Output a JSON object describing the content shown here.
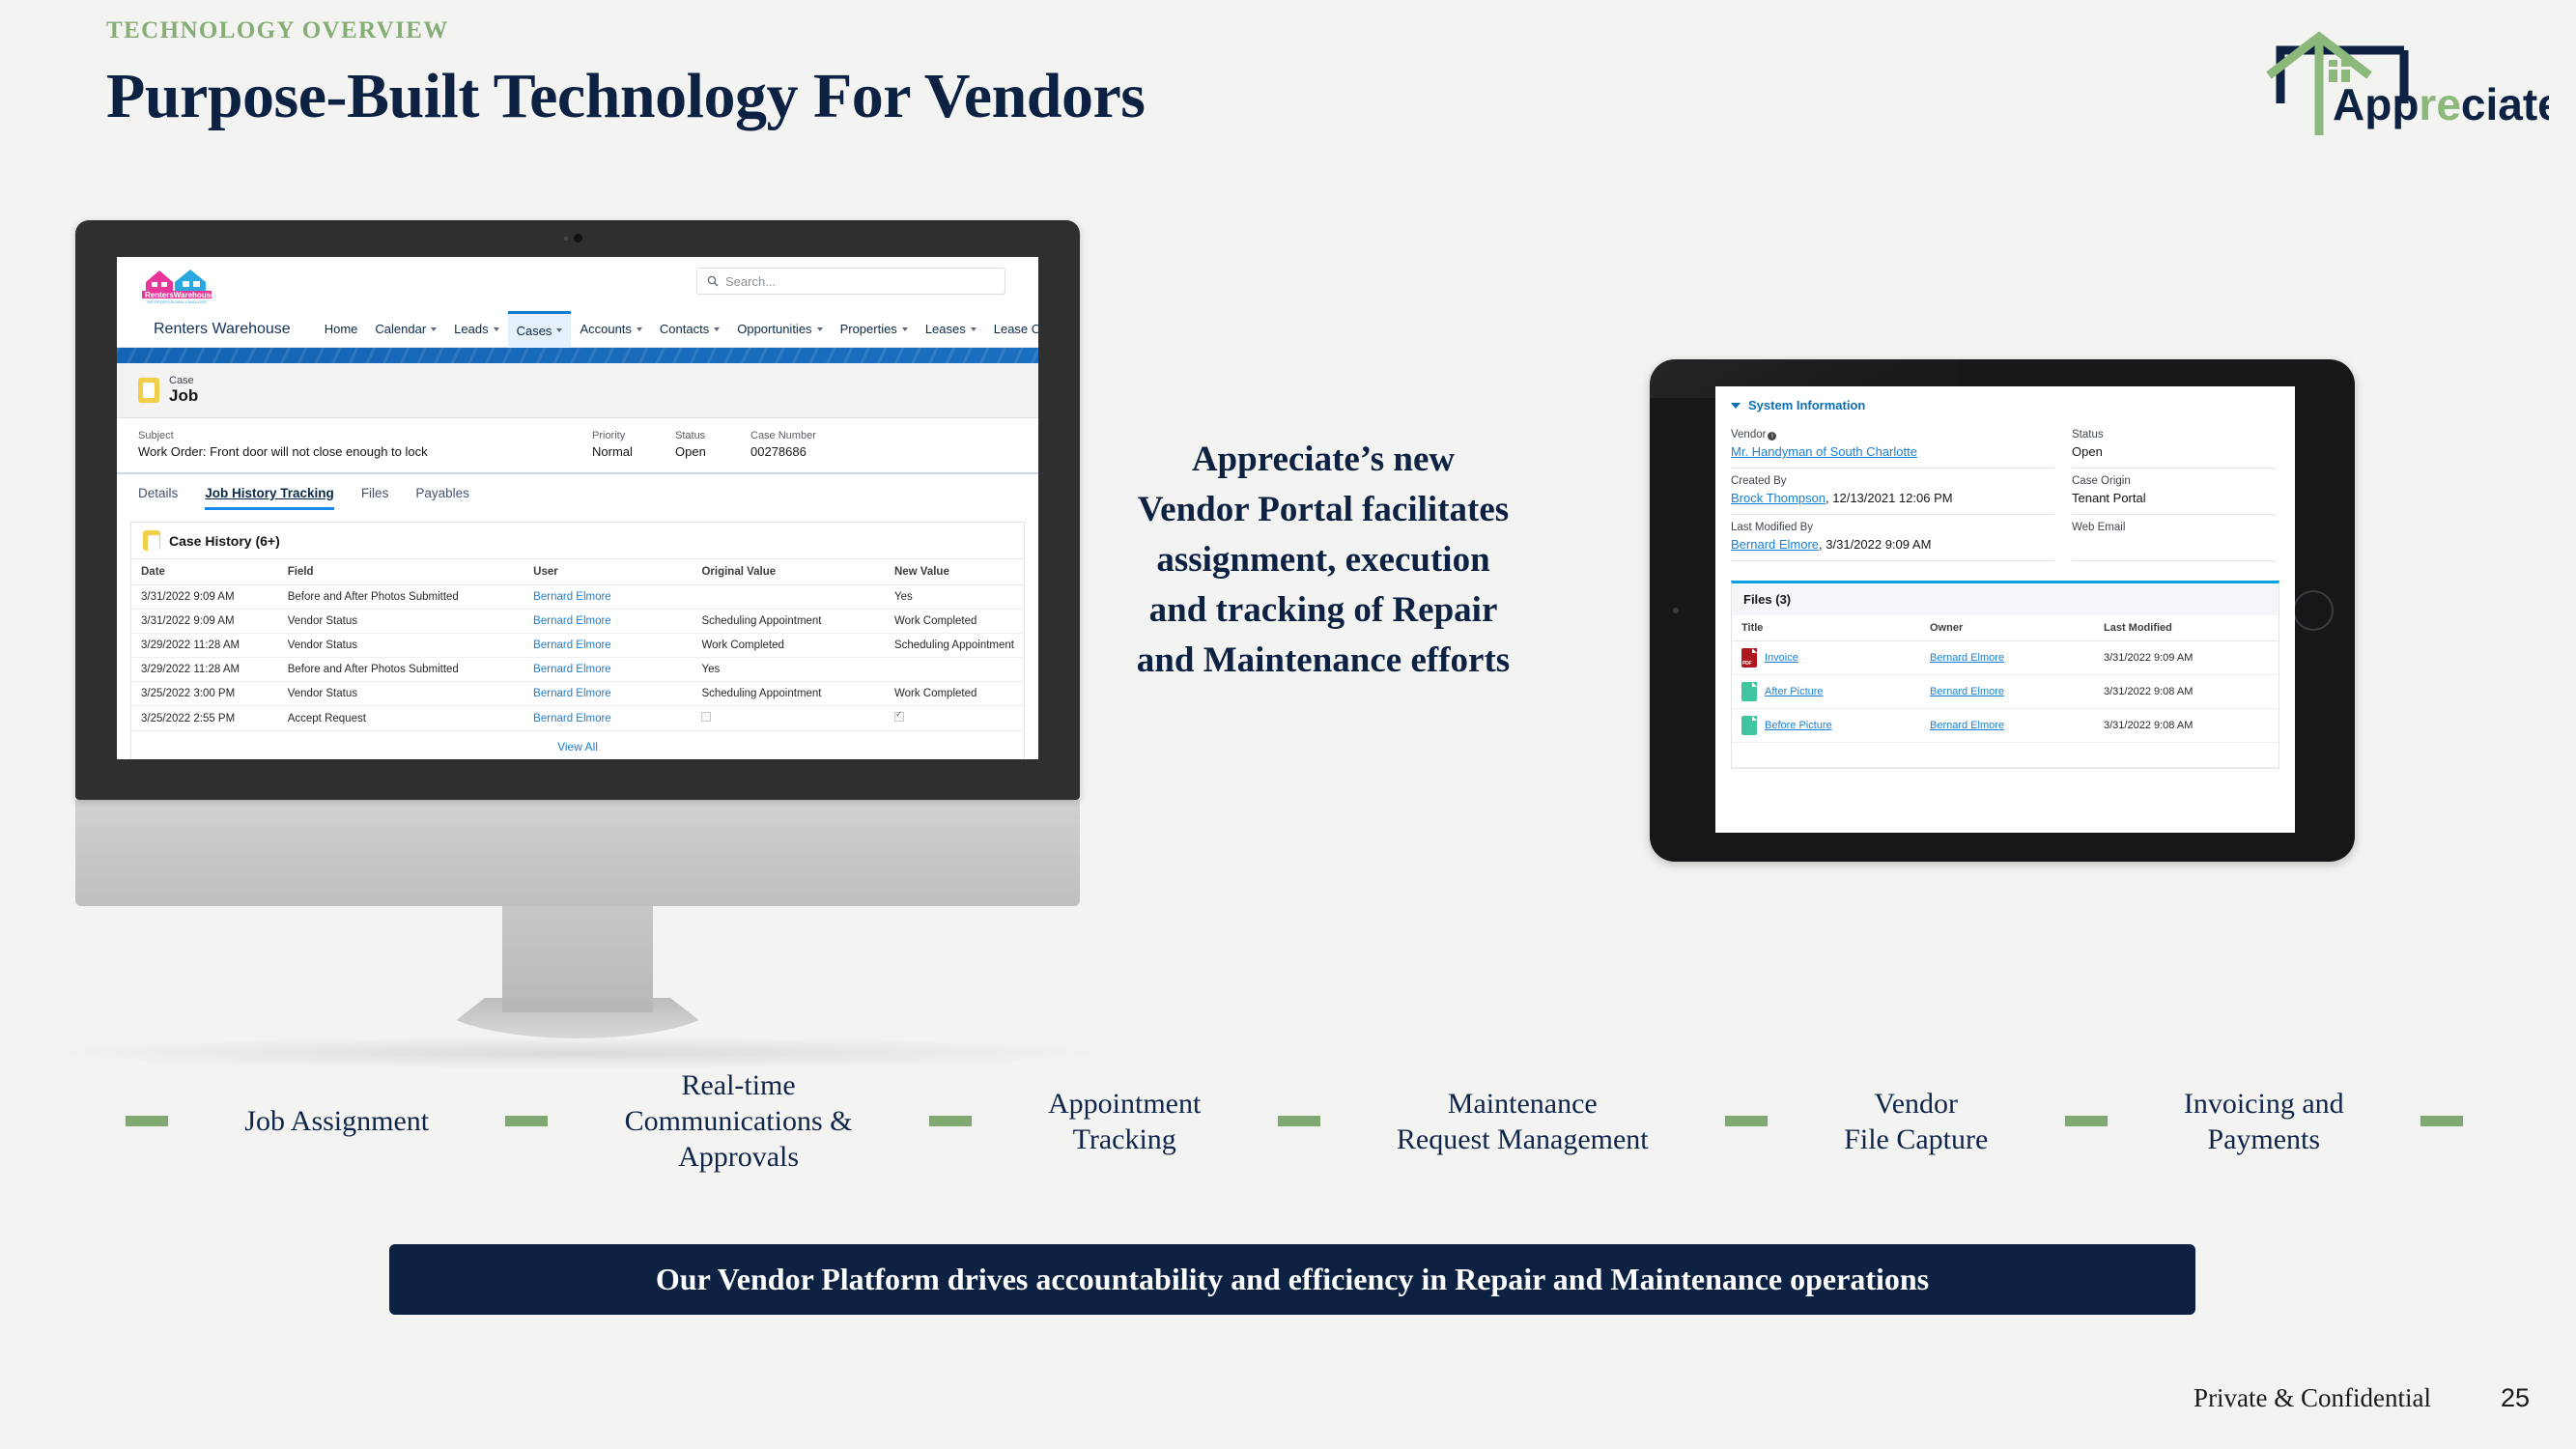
{
  "header": {
    "eyebrow": "TECHNOLOGY OVERVIEW",
    "title": "Purpose-Built Technology For Vendors",
    "logo_text_a": "App",
    "logo_text_b": "re",
    "logo_text_c": "ciate"
  },
  "colors": {
    "navy": "#0d2243",
    "green": "#7fa872",
    "eyebrow_green": "#87ad77",
    "page_bg": "#f3f3f2",
    "sf_blue": "#1a7fd4"
  },
  "desktop": {
    "topbar": {
      "brand_logo": "renters-warehouse-logo",
      "search_placeholder": "Search...",
      "search_icon": "search-icon",
      "waffle_icon": "app-launcher-icon"
    },
    "app_name": "Renters Warehouse",
    "nav_items": [
      {
        "label": "Home",
        "has_menu": false,
        "active": false
      },
      {
        "label": "Calendar",
        "has_menu": true,
        "active": false
      },
      {
        "label": "Leads",
        "has_menu": true,
        "active": false
      },
      {
        "label": "Cases",
        "has_menu": true,
        "active": true
      },
      {
        "label": "Accounts",
        "has_menu": true,
        "active": false
      },
      {
        "label": "Contacts",
        "has_menu": true,
        "active": false
      },
      {
        "label": "Opportunities",
        "has_menu": true,
        "active": false
      },
      {
        "label": "Properties",
        "has_menu": true,
        "active": false
      },
      {
        "label": "Leases",
        "has_menu": true,
        "active": false
      },
      {
        "label": "Lease Contacts",
        "has_menu": false,
        "active": false
      }
    ],
    "record": {
      "type_label": "Case",
      "title": "Job",
      "icon": "case-icon"
    },
    "fields": [
      {
        "label": "Subject",
        "value": "Work Order: Front door will not close enough to lock"
      },
      {
        "label": "Priority",
        "value": "Normal"
      },
      {
        "label": "Status",
        "value": "Open"
      },
      {
        "label": "Case Number",
        "value": "00278686"
      }
    ],
    "tabs": [
      {
        "label": "Details",
        "selected": false
      },
      {
        "label": "Job History Tracking",
        "selected": true
      },
      {
        "label": "Files",
        "selected": false
      },
      {
        "label": "Payables",
        "selected": false
      }
    ],
    "case_history": {
      "title": "Case History (6+)",
      "columns": [
        "Date",
        "Field",
        "User",
        "Original Value",
        "New Value"
      ],
      "rows": [
        [
          "3/31/2022 9:09 AM",
          "Before and After Photos Submitted",
          "Bernard Elmore",
          "",
          "Yes"
        ],
        [
          "3/31/2022 9:09 AM",
          "Vendor Status",
          "Bernard Elmore",
          "Scheduling Appointment",
          "Work Completed"
        ],
        [
          "3/29/2022 11:28 AM",
          "Vendor Status",
          "Bernard Elmore",
          "Work Completed",
          "Scheduling Appointment"
        ],
        [
          "3/29/2022 11:28 AM",
          "Before and After Photos Submitted",
          "Bernard Elmore",
          "Yes",
          ""
        ],
        [
          "3/25/2022 3:00 PM",
          "Vendor Status",
          "Bernard Elmore",
          "Scheduling Appointment",
          "Work Completed"
        ],
        [
          "3/25/2022 2:55 PM",
          "Accept Request",
          "Bernard Elmore",
          "[checkbox-off]",
          "[checkbox-on]"
        ]
      ],
      "view_all": "View All"
    }
  },
  "center_copy": "Appreciate’s new Vendor Portal facilitates assignment, execution and tracking of Repair and Maintenance efforts",
  "tablet": {
    "section_title": "System Information",
    "left_fields": [
      {
        "label": "Vendor",
        "value": "Mr. Handyman of South Charlotte",
        "link": true,
        "info_icon": true
      },
      {
        "label": "Created By",
        "value": "Brock Thompson",
        "suffix": ", 12/13/2021 12:06 PM",
        "link": true
      },
      {
        "label": "Last Modified By",
        "value": "Bernard Elmore",
        "suffix": ", 3/31/2022 9:09 AM",
        "link": true
      }
    ],
    "right_fields": [
      {
        "label": "Status",
        "value": "Open"
      },
      {
        "label": "Case Origin",
        "value": "Tenant Portal"
      },
      {
        "label": "Web Email",
        "value": ""
      }
    ],
    "files": {
      "title": "Files (3)",
      "columns": [
        "Title",
        "Owner",
        "Last Modified"
      ],
      "rows": [
        {
          "icon": "pdf-file-icon",
          "icon_kind": "pdf",
          "title": "Invoice",
          "owner": "Bernard Elmore",
          "modified": "3/31/2022 9:09 AM"
        },
        {
          "icon": "image-file-icon",
          "icon_kind": "img",
          "title": "After Picture",
          "owner": "Bernard Elmore",
          "modified": "3/31/2022 9:08 AM"
        },
        {
          "icon": "image-file-icon",
          "icon_kind": "img",
          "title": "Before Picture",
          "owner": "Bernard Elmore",
          "modified": "3/31/2022 9:08 AM"
        }
      ]
    }
  },
  "features": [
    "Job Assignment",
    "Real-time\nCommunications &\nApprovals",
    "Appointment\nTracking",
    "Maintenance\nRequest Management",
    "Vendor\nFile Capture",
    "Invoicing and\nPayments"
  ],
  "banner": "Our Vendor Platform drives accountability and efficiency in Repair and Maintenance operations",
  "footer": {
    "confidential": "Private & Confidential",
    "page_number": "25"
  }
}
